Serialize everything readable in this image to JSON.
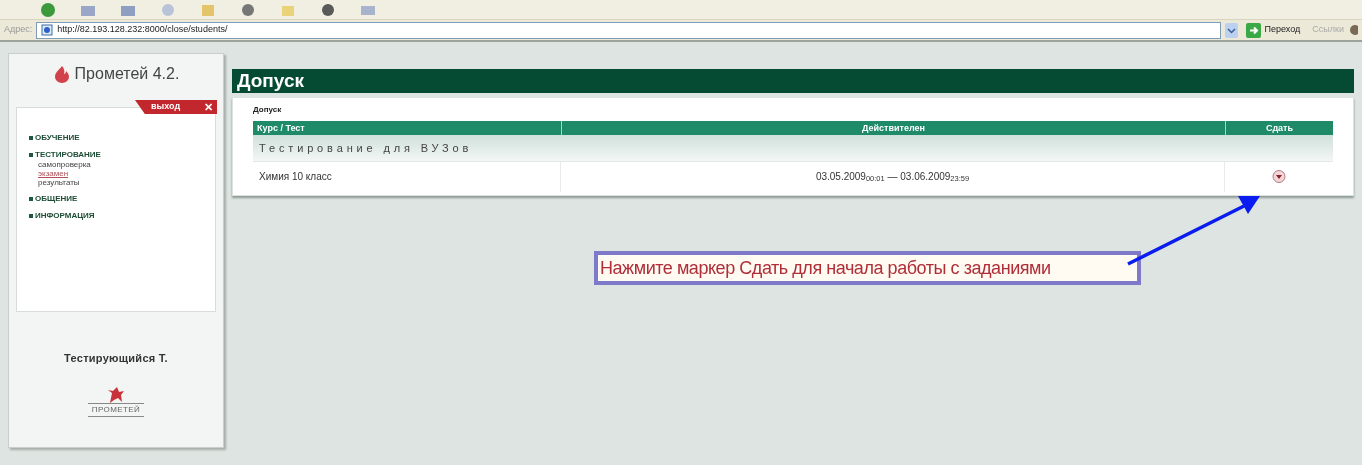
{
  "browser": {
    "address_label": "Адрес:",
    "url": "http://82.193.128.232:8000/close/students/",
    "go_button": "Переход",
    "links_label": "Ссылки"
  },
  "sidebar": {
    "logo_text": "Прометей 4.2.",
    "logout_button": "выход",
    "close_mark": "✕",
    "menu": [
      {
        "label": "ОБУЧЕНИЕ"
      },
      {
        "label": "ТЕСТИРОВАНИЕ",
        "children": [
          {
            "label": "самопроверка",
            "selected": false
          },
          {
            "label": "экзамен",
            "selected": true
          },
          {
            "label": "результаты",
            "selected": false
          }
        ]
      },
      {
        "label": "ОБЩЕНИЕ"
      },
      {
        "label": "ИНФОРМАЦИЯ"
      }
    ],
    "user_name": "Тестирующийся Т.",
    "footer_logo_text": "ПРОМЕТЕЙ"
  },
  "page": {
    "title": "Допуск",
    "subtitle": "Допуск",
    "table": {
      "columns": [
        "Курс / Тест",
        "Действителен",
        "Сдать"
      ],
      "groups": [
        {
          "title": "Тестирование для ВУЗов",
          "rows": [
            {
              "course": "Химия 10 класс",
              "valid": "03.05.2009$_{00:01}$ — 03.06.2009$_{23:59}$"
            }
          ]
        }
      ]
    }
  },
  "hint": "Нажмите маркер Сдать для начала работы с заданиями"
}
